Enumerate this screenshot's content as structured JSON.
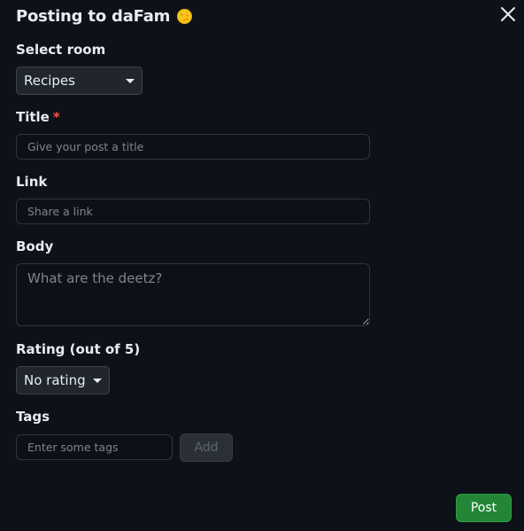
{
  "dialog": {
    "title": "Posting to daFam",
    "title_icon": "sunflower-emoji-icon",
    "close_icon": "close-icon"
  },
  "room": {
    "label": "Select room",
    "selected": "Recipes"
  },
  "title_field": {
    "label": "Title",
    "required_marker": "*",
    "placeholder": "Give your post a title",
    "value": ""
  },
  "link_field": {
    "label": "Link",
    "placeholder": "Share a link",
    "value": ""
  },
  "body_field": {
    "label": "Body",
    "placeholder": "What are the deetz?",
    "value": ""
  },
  "rating": {
    "label": "Rating (out of 5)",
    "selected": "No rating"
  },
  "tags": {
    "label": "Tags",
    "placeholder": "Enter some tags",
    "add_label": "Add"
  },
  "actions": {
    "post_label": "Post"
  },
  "colors": {
    "background": "#0e1117",
    "accent_green": "#238636",
    "required_red": "#f85149"
  }
}
